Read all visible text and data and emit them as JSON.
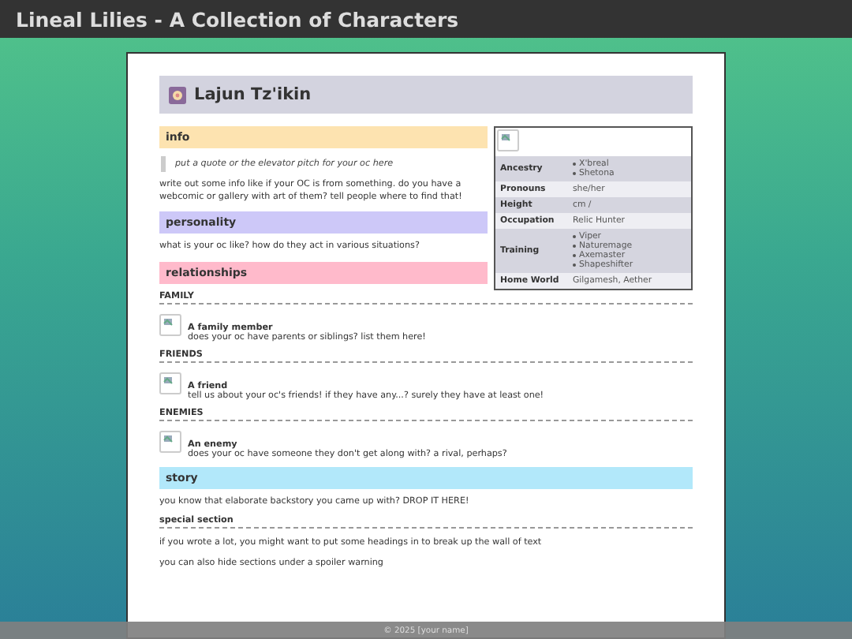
{
  "site_title": "Lineal Lilies - A Collection of Characters",
  "character": {
    "name": "Lajun Tz'ikin"
  },
  "infobox": {
    "rows": [
      {
        "label": "Ancestry",
        "kind": "list",
        "values": [
          "X'breal",
          "Shetona"
        ]
      },
      {
        "label": "Pronouns",
        "kind": "text",
        "values": [
          "she/her"
        ]
      },
      {
        "label": "Height",
        "kind": "text",
        "values": [
          "cm /"
        ]
      },
      {
        "label": "Occupation",
        "kind": "text",
        "values": [
          "Relic Hunter"
        ]
      },
      {
        "label": "Training",
        "kind": "list",
        "values": [
          "Viper",
          "Naturemage",
          "Axemaster",
          "Shapeshifter"
        ]
      },
      {
        "label": "Home World",
        "kind": "text",
        "values": [
          "Gilgamesh, Aether"
        ]
      }
    ]
  },
  "sections": [
    {
      "title": "info",
      "color": "#fde3b0",
      "quote": "put a quote or the elevator pitch for your oc here",
      "paragraphs": [
        "write out some info like if your OC is from something. do you have a webcomic or gallery with art of them? tell people where to find that!"
      ]
    },
    {
      "title": "personality",
      "color": "#cdc8f8",
      "paragraphs": [
        "what is your oc like? how do they act in various situations?"
      ]
    },
    {
      "title": "relationships",
      "color": "#ffbacb",
      "groups": [
        {
          "heading": "FAMILY",
          "entries": [
            {
              "name": "A family member",
              "description": "does your oc have parents or siblings? list them here!"
            }
          ]
        },
        {
          "heading": "FRIENDS",
          "entries": [
            {
              "name": "A friend",
              "description": "tell us about your oc's friends! if they have any...? surely they have at least one!"
            }
          ]
        },
        {
          "heading": "ENEMIES",
          "entries": [
            {
              "name": "An enemy",
              "description": "does your oc have someone they don't get along with? a rival, perhaps?"
            }
          ]
        }
      ]
    },
    {
      "title": "story",
      "color": "#b2e8fa",
      "paragraphs": [
        "you know that elaborate backstory you came up with? DROP IT HERE!"
      ],
      "subsections": [
        {
          "heading": "special section",
          "paragraphs": [
            "if you wrote a lot, you might want to put some headings in to break up the wall of text",
            "you can also hide sections under a spoiler warning"
          ]
        }
      ]
    }
  ],
  "footer": "© 2025 [your name]"
}
